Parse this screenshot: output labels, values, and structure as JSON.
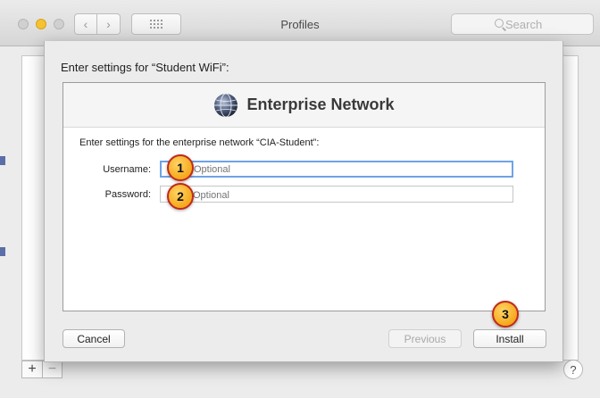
{
  "window": {
    "title": "Profiles",
    "search_placeholder": "Search",
    "add_label": "+",
    "remove_label": "−",
    "help_label": "?"
  },
  "sheet": {
    "prompt": "Enter settings for “Student WiFi”:",
    "header_title": "Enterprise Network",
    "description": "Enter settings for the enterprise network “CIA-Student”:",
    "username_label": "Username:",
    "username_placeholder": "Optional",
    "password_label": "Password:",
    "password_placeholder": "Optional",
    "cancel_label": "Cancel",
    "previous_label": "Previous",
    "install_label": "Install"
  },
  "callouts": [
    "1",
    "2",
    "3"
  ],
  "colors": {
    "callout_fill": "#f5a81c",
    "callout_ring": "#c0291c",
    "focus_ring": "#6fa3e6",
    "close_button": "#d0d0d0",
    "minimize_button": "#f5c232"
  },
  "icons": {
    "back": "chevron-left-icon",
    "forward": "chevron-right-icon",
    "grid": "grid-icon",
    "search": "search-icon",
    "globe": "globe-network-icon"
  }
}
